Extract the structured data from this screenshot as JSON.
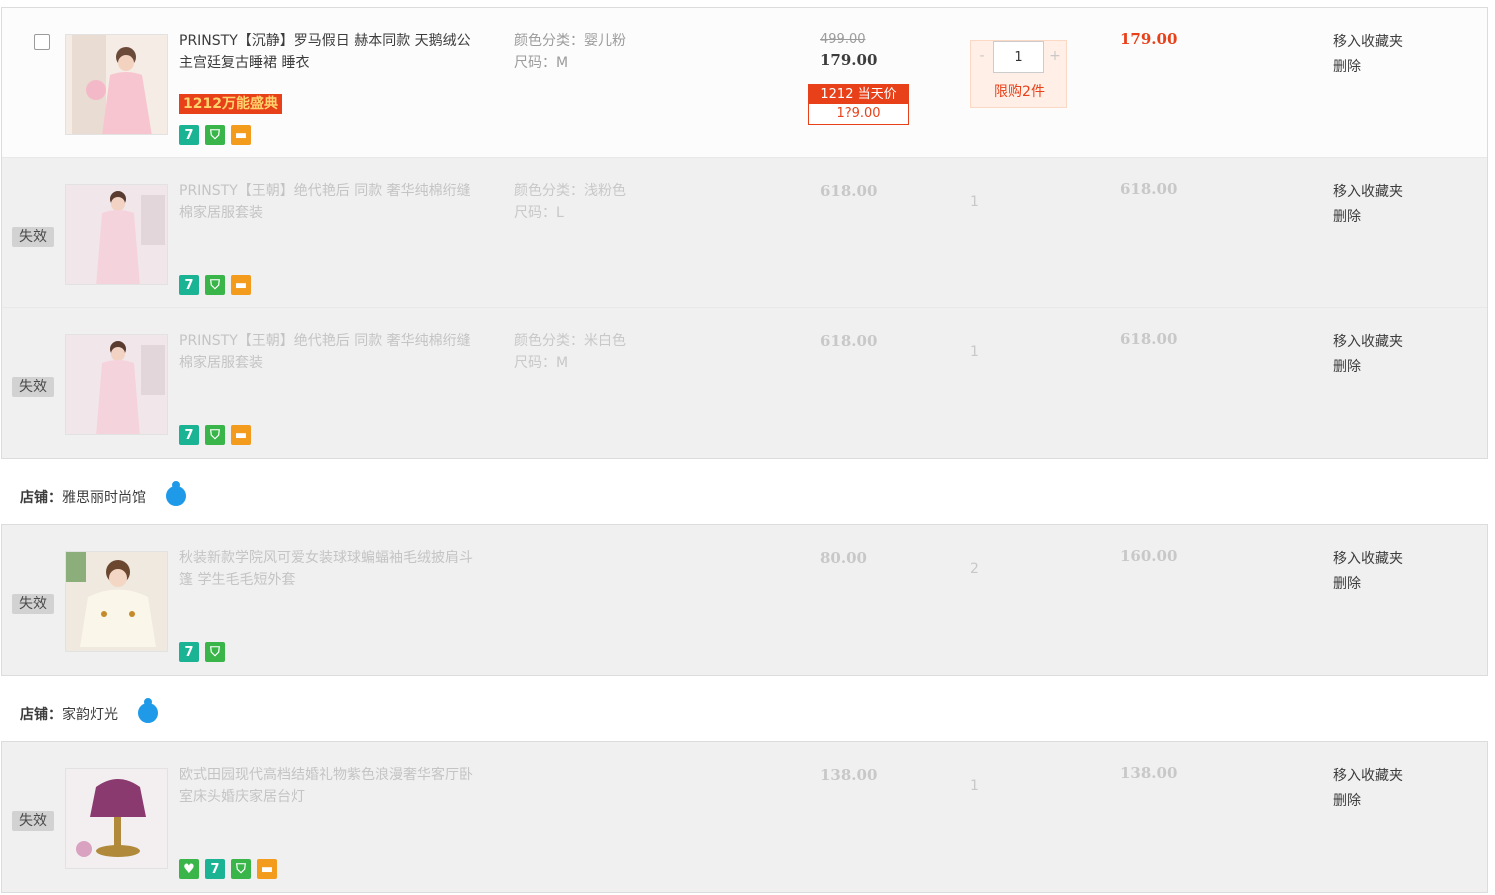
{
  "groups": [
    {
      "items": [
        {
          "title": "PRINSTY【沉静】罗马假日 赫本同款 天鹅绒公主宫廷复古睡裙 睡衣",
          "promo": "1212万能盛典",
          "color": "颜色分类：婴儿粉",
          "size": "尺码：M",
          "orig_price": "499.00",
          "price": "179.00",
          "deal_label": "1212 当天价",
          "deal_price": "1?9.00",
          "qty": "1",
          "qty_minus": "-",
          "qty_plus": "+",
          "limit": "限购2件",
          "subtotal": "179.00",
          "op_fav": "移入收藏夹",
          "op_del": "删除"
        },
        {
          "invalid_tag": "失效",
          "title": "PRINSTY【王朝】绝代艳后 同款 奢华纯棉绗缝棉家居服套装",
          "color": "颜色分类：浅粉色",
          "size": "尺码：L",
          "price": "618.00",
          "qty": "1",
          "subtotal": "618.00",
          "op_fav": "移入收藏夹",
          "op_del": "删除"
        },
        {
          "invalid_tag": "失效",
          "title": "PRINSTY【王朝】绝代艳后 同款 奢华纯棉绗缝棉家居服套装",
          "color": "颜色分类：米白色",
          "size": "尺码：M",
          "price": "618.00",
          "qty": "1",
          "subtotal": "618.00",
          "op_fav": "移入收藏夹",
          "op_del": "删除"
        }
      ]
    },
    {
      "shop_label": "店铺：",
      "shop_name": "雅思丽时尚馆",
      "items": [
        {
          "invalid_tag": "失效",
          "title": "秋装新款学院风可爱女装球球蝙蝠袖毛绒披肩斗篷 学生毛毛短外套",
          "price": "80.00",
          "qty": "2",
          "subtotal": "160.00",
          "op_fav": "移入收藏夹",
          "op_del": "删除"
        }
      ]
    },
    {
      "shop_label": "店铺：",
      "shop_name": "家韵灯光",
      "items": [
        {
          "invalid_tag": "失效",
          "title": "欧式田园现代高档结婚礼物紫色浪漫奢华客厅卧室床头婚庆家居台灯",
          "price": "138.00",
          "qty": "1",
          "subtotal": "138.00",
          "op_fav": "移入收藏夹",
          "op_del": "删除"
        }
      ]
    }
  ],
  "colors": {
    "accent": "#e8411a",
    "invalid_bg": "#f0f0f0",
    "wangwang": "#1e9ae8"
  }
}
